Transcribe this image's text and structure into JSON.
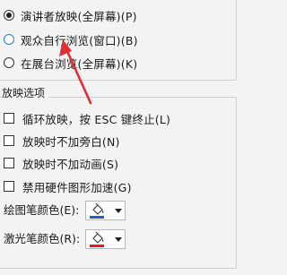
{
  "show_type": {
    "options": [
      {
        "label": "演讲者放映(全屏幕)(P)",
        "selected": true
      },
      {
        "label": "观众自行浏览(窗口)(B)",
        "selected": false
      },
      {
        "label": "在展台浏览(全屏幕)(K)",
        "selected": false
      }
    ]
  },
  "show_options": {
    "title": "放映选项",
    "checkboxes": [
      {
        "label": "循环放映，按 ESC 键终止(L)",
        "checked": false
      },
      {
        "label": "放映时不加旁白(N)",
        "checked": false
      },
      {
        "label": "放映时不加动画(S)",
        "checked": false
      },
      {
        "label": "禁用硬件图形加速(G)",
        "checked": false
      }
    ],
    "pen_color": {
      "label": "绘图笔颜色(E):",
      "color": "#1f5fbf",
      "icon": "paint-bucket-icon"
    },
    "laser_color": {
      "label": "激光笔颜色(R):",
      "color": "#e8191c",
      "icon": "paint-bucket-icon"
    }
  },
  "annotation": {
    "arrow_color": "#e52b36"
  }
}
